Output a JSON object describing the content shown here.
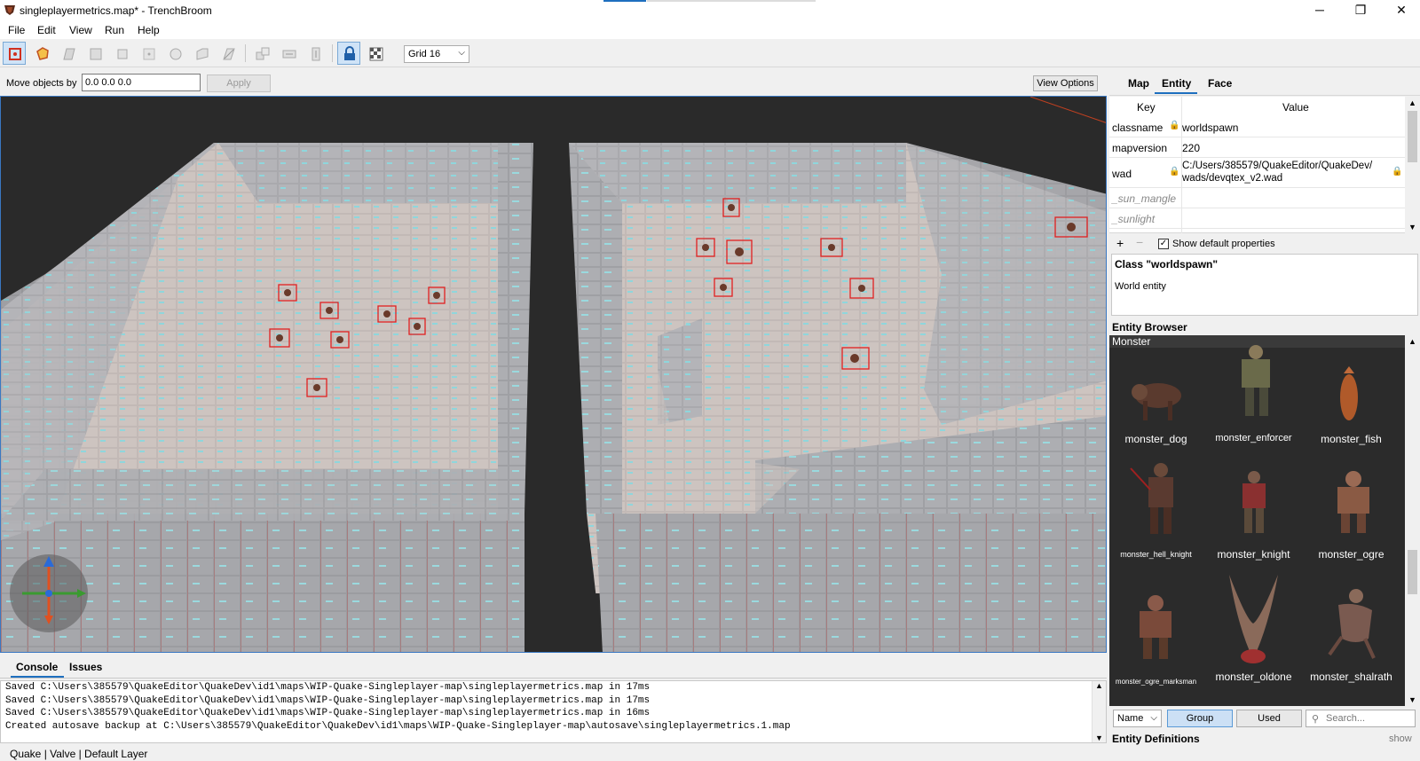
{
  "window": {
    "title": "singleplayermetrics.map* - TrenchBroom",
    "controls": [
      "─",
      "❐",
      "✕"
    ]
  },
  "menu": [
    "File",
    "Edit",
    "View",
    "Run",
    "Help"
  ],
  "toolbar": {
    "grid_select": "Grid 16"
  },
  "movebar": {
    "label": "Move objects by",
    "value": "0.0 0.0 0.0",
    "apply": "Apply",
    "view_options": "View Options"
  },
  "console": {
    "tabs": [
      "Console",
      "Issues"
    ],
    "lines": [
      "Saved C:\\Users\\385579\\QuakeEditor\\QuakeDev\\id1\\maps\\WIP-Quake-Singleplayer-map\\singleplayermetrics.map in 17ms",
      "Saved C:\\Users\\385579\\QuakeEditor\\QuakeDev\\id1\\maps\\WIP-Quake-Singleplayer-map\\singleplayermetrics.map in 17ms",
      "Saved C:\\Users\\385579\\QuakeEditor\\QuakeDev\\id1\\maps\\WIP-Quake-Singleplayer-map\\singleplayermetrics.map in 16ms",
      "Created autosave backup at C:\\Users\\385579\\QuakeEditor\\QuakeDev\\id1\\maps\\WIP-Quake-Singleplayer-map\\autosave\\singleplayermetrics.1.map"
    ]
  },
  "status": "Quake  |  Valve  |  Default Layer",
  "inspector": {
    "tabs": [
      "Map",
      "Entity",
      "Face"
    ],
    "columns": {
      "key": "Key",
      "value": "Value"
    },
    "rows": [
      {
        "key": "classname",
        "value": "worldspawn",
        "value2": ""
      },
      {
        "key": "mapversion",
        "value": "220",
        "value2": ""
      },
      {
        "key": "wad",
        "value": "C:/Users/385579/QuakeEditor/QuakeDev/",
        "value2": "wads/devqtex_v2.wad"
      },
      {
        "key": "_sun_mangle",
        "value": "",
        "value2": ""
      },
      {
        "key": "_sunlight",
        "value": "",
        "value2": ""
      }
    ],
    "show_default": "Show default properties",
    "class_title": "Class \"worldspawn\"",
    "class_desc": "World entity"
  },
  "entity_browser": {
    "title": "Entity Browser",
    "group": "Monster",
    "entities": [
      {
        "name": "monster_dog",
        "color": "#6b4a3a"
      },
      {
        "name": "monster_enforcer",
        "color": "#6a6a4a"
      },
      {
        "name": "monster_fish",
        "color": "#b05a2a"
      },
      {
        "name": "monster_hell_knight",
        "color": "#5a3a30"
      },
      {
        "name": "monster_knight",
        "color": "#7a5a4a"
      },
      {
        "name": "monster_ogre",
        "color": "#8a5a44"
      },
      {
        "name": "monster_ogre_marksman",
        "color": "#7a4a3a"
      },
      {
        "name": "monster_oldone",
        "color": "#8a6a5a"
      },
      {
        "name": "monster_shalrath",
        "color": "#7a5a50"
      }
    ],
    "sort": "Name",
    "group_btn": "Group",
    "used_btn": "Used",
    "search_placeholder": "Search..."
  },
  "entity_definitions": {
    "title": "Entity Definitions",
    "show": "show"
  },
  "colors": {
    "accent": "#1e6fbf",
    "selection_red": "#e02020"
  }
}
